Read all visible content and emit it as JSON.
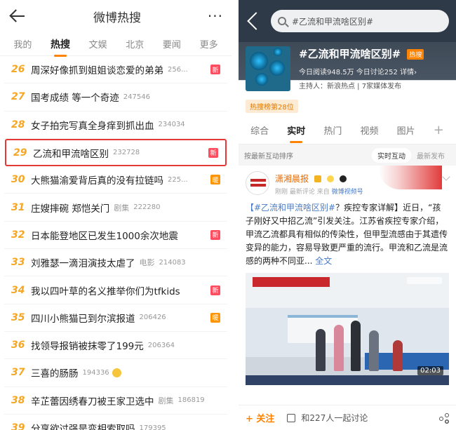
{
  "left": {
    "title": "微博热搜",
    "tabs": [
      {
        "label": "我的",
        "active": false
      },
      {
        "label": "热搜",
        "active": true
      },
      {
        "label": "文娱",
        "active": false
      },
      {
        "label": "北京",
        "active": false
      },
      {
        "label": "要闻",
        "active": false
      },
      {
        "label": "更多",
        "active": false
      }
    ],
    "rows": [
      {
        "rank": "26",
        "topic": "周深好像抓到姐姐谈恋爱的弟弟",
        "extra": "",
        "count": "256...",
        "badge": "新",
        "highlight": false
      },
      {
        "rank": "27",
        "topic": "国考成绩 等一个奇迹",
        "extra": "",
        "count": "247546",
        "badge": "",
        "highlight": false
      },
      {
        "rank": "28",
        "topic": "女子拍完写真全身痒到抓出血",
        "extra": "",
        "count": "234034",
        "badge": "",
        "highlight": false
      },
      {
        "rank": "29",
        "topic": "乙流和甲流啥区别",
        "extra": "",
        "count": "232728",
        "badge": "新",
        "highlight": true
      },
      {
        "rank": "30",
        "topic": "大熊猫渝爱背后真的没有拉链吗",
        "extra": "",
        "count": "225...",
        "badge": "暖",
        "highlight": false
      },
      {
        "rank": "31",
        "topic": "庄嫂摔碗 郑恺关门",
        "extra": "剧集",
        "count": "222280",
        "badge": "",
        "highlight": false
      },
      {
        "rank": "32",
        "topic": "日本能登地区已发生1000余次地震",
        "extra": "",
        "count": "",
        "badge": "新",
        "highlight": false
      },
      {
        "rank": "33",
        "topic": "刘雅瑟一滴泪演技太虐了",
        "extra": "电影",
        "count": "214083",
        "badge": "",
        "highlight": false
      },
      {
        "rank": "34",
        "topic": "我以四叶草的名义推举你们为tfkids",
        "extra": "",
        "count": "",
        "badge": "新",
        "highlight": false
      },
      {
        "rank": "35",
        "topic": "四川小熊猫已到尔滨报道",
        "extra": "",
        "count": "206426",
        "badge": "暖",
        "highlight": false
      },
      {
        "rank": "36",
        "topic": "找领导报销被抹零了199元",
        "extra": "",
        "count": "206364",
        "badge": "",
        "highlight": false
      },
      {
        "rank": "37",
        "topic": "三喜的肠肠",
        "extra": "",
        "count": "194336",
        "badge": "",
        "highlight": false,
        "emoji": true
      },
      {
        "rank": "38",
        "topic": "辛芷蕾因绣春刀被王家卫选中",
        "extra": "剧集",
        "count": "186819",
        "badge": "",
        "highlight": false
      },
      {
        "rank": "39",
        "topic": "分享欲过强是变相索取吗",
        "extra": "",
        "count": "179395",
        "badge": "",
        "highlight": false
      }
    ]
  },
  "right": {
    "search_text": "#乙流和甲流啥区别#",
    "topic_title": "#乙流和甲流啥区别#",
    "hot_tag": "热搜",
    "stats": "今日阅读948.5万  今日讨论252  详情›",
    "host": "主持人：新浪热点 | 7家媒体发布",
    "rank_tag": "热搜榜第28位",
    "tabs": [
      {
        "label": "综合",
        "active": false
      },
      {
        "label": "实时",
        "active": true
      },
      {
        "label": "热门",
        "active": false
      },
      {
        "label": "视频",
        "active": false
      },
      {
        "label": "图片",
        "active": false
      }
    ],
    "plus": "+",
    "sort_label": "按最新互动排序",
    "sort_opts": [
      {
        "label": "实时互动",
        "active": true
      },
      {
        "label": "最新发布",
        "active": false
      }
    ],
    "post": {
      "author": "潇湘晨报",
      "meta_time": "刚刚 最新评论",
      "meta_from": "来自",
      "meta_source": "微博视频号",
      "body_tag": "【#乙流和甲流啥区别#",
      "body_text": "？疾控专家详解】近日，“孩子刚好又中招乙流”引发关注。江苏省疾控专家介绍，甲流乙流都具有相似的传染性，但甲型流感由于其遗传变异的能力，容易导致更严重的流行。甲流和乙流是流感的两种不同亚...",
      "body_more": "全文",
      "video_time": "02:03"
    },
    "bottom": {
      "follow": "+ 关注",
      "comment": "和227人一起讨论"
    }
  },
  "colors": {
    "accent": "#ff8200",
    "rank": "#f5a623",
    "badge_new": "#ff4c5e",
    "badge_warm": "#ff9406",
    "highlight_border": "#e53935"
  }
}
